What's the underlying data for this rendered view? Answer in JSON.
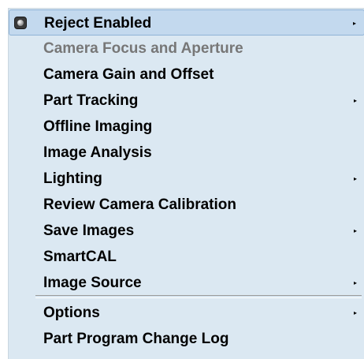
{
  "menu": {
    "items": [
      {
        "label": "Reject Enabled",
        "submenu": true,
        "checked": true,
        "disabled": false,
        "highlighted": true
      },
      {
        "label": "Camera Focus and Aperture",
        "submenu": false,
        "checked": false,
        "disabled": true,
        "highlighted": false
      },
      {
        "label": "Camera Gain and Offset",
        "submenu": false,
        "checked": false,
        "disabled": false,
        "highlighted": false
      },
      {
        "label": "Part Tracking",
        "submenu": true,
        "checked": false,
        "disabled": false,
        "highlighted": false
      },
      {
        "label": "Offline Imaging",
        "submenu": false,
        "checked": false,
        "disabled": false,
        "highlighted": false
      },
      {
        "label": "Image Analysis",
        "submenu": false,
        "checked": false,
        "disabled": false,
        "highlighted": false
      },
      {
        "label": "Lighting",
        "submenu": true,
        "checked": false,
        "disabled": false,
        "highlighted": false
      },
      {
        "label": "Review Camera Calibration",
        "submenu": false,
        "checked": false,
        "disabled": false,
        "highlighted": false
      },
      {
        "label": "Save Images",
        "submenu": true,
        "checked": false,
        "disabled": false,
        "highlighted": false
      },
      {
        "label": "SmartCAL",
        "submenu": false,
        "checked": false,
        "disabled": false,
        "highlighted": false
      },
      {
        "label": "Image Source",
        "submenu": true,
        "checked": false,
        "disabled": false,
        "highlighted": false
      },
      {
        "label": "Options",
        "submenu": true,
        "checked": false,
        "disabled": false,
        "highlighted": false
      },
      {
        "label": "Part Program Change Log",
        "submenu": false,
        "checked": false,
        "disabled": false,
        "highlighted": false
      }
    ],
    "submenu_arrow": "▸",
    "colors": {
      "background": "#dbe8f2",
      "highlight": "#c3d9ee",
      "disabled_text": "#777777",
      "text": "#000000"
    }
  }
}
